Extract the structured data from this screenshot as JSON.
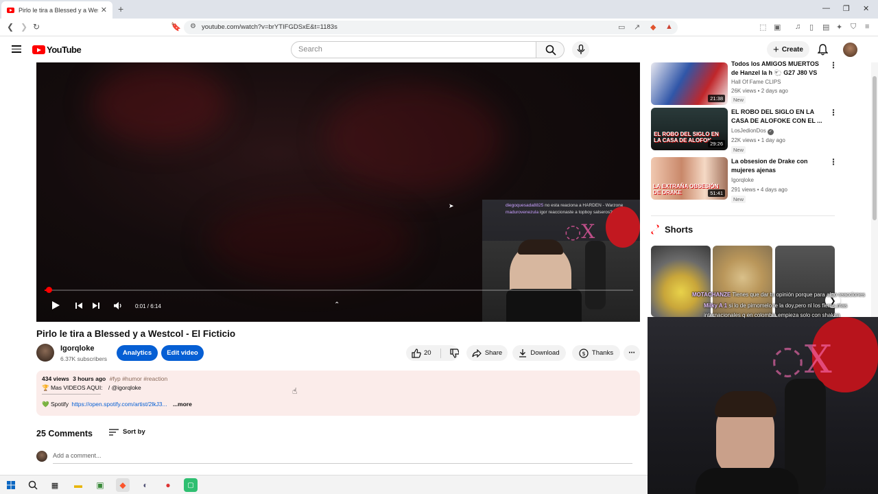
{
  "browser": {
    "tab_title": "Pirlo le tira a Blessed y a Westco",
    "url": "youtube.com/watch?v=brYTIFGDSxE&t=1183s"
  },
  "header": {
    "logo_text": "YouTube",
    "search_placeholder": "Search",
    "create_label": "Create"
  },
  "player": {
    "time": "0:01 / 6:14",
    "progress_fraction": 0.003,
    "chat_lines": [
      {
        "user": "diegoquesada8825",
        "text": "no esta reaciona a HARDEN - Warzone"
      },
      {
        "user": "madurovenezula",
        "text": "igor reaccionaste a topboy salseros?"
      }
    ]
  },
  "video": {
    "title": "Pirlo le tira a Blessed y a Westcol - El Ficticio",
    "channel": "Igorqloke",
    "subscribers": "6.37K subscribers",
    "analytics_label": "Analytics",
    "edit_label": "Edit video",
    "likes": "20",
    "share_label": "Share",
    "download_label": "Download",
    "thanks_label": "Thanks"
  },
  "description": {
    "views": "434 views",
    "age": "3 hours ago",
    "tags": "#fyp #humor #reaction",
    "line1_emoji": "🏆",
    "line1": "Mas VIDEOS AQUI:",
    "line1_handle": "/ @igorqloke",
    "divider": "-------------------------------------------",
    "spotify_emoji": "💚",
    "spotify_label": "Spotify",
    "spotify_link": "https://open.spotify.com/artist/2lkJ3...",
    "more_label": "...more"
  },
  "comments": {
    "count": "25 Comments",
    "sort_label": "Sort by",
    "placeholder": "Add a comment..."
  },
  "sidebar": {
    "recommendations": [
      {
        "title": "Todos los AMIGOS MUERTOS de Hanzel la h 🐑 G27 J80 VS ...",
        "channel": "Hall Of Fame CLIPS",
        "meta": "26K views • 2 days ago",
        "badge": "New",
        "duration": "21:38"
      },
      {
        "title": "EL ROBO DEL SIGLO EN LA CASA DE ALOFOKE CON EL ...",
        "channel": "LosJedionDos",
        "meta": "22K views • 1 day ago",
        "badge": "New",
        "duration": "29:26"
      },
      {
        "title": "La obsesion de Drake con mujeres ajenas",
        "channel": "Igorqloke",
        "meta": "291 views • 4 days ago",
        "badge": "New",
        "duration": "51:41"
      }
    ],
    "shorts_label": "Shorts"
  },
  "overlay_chat": [
    {
      "user": "MOTACHANZE",
      "text": "Tienes que dar tu opinión porque para algo reacciones"
    },
    {
      "user": "Milky A 1",
      "text": "si lo de pirnomelo te la doy,pero nl los fleros mas internacionales q en colombia empieza solo con shakira"
    }
  ],
  "colors": {
    "brand_red": "#ff0000",
    "accent_blue": "#065fd4",
    "description_bg": "#fbecea"
  }
}
